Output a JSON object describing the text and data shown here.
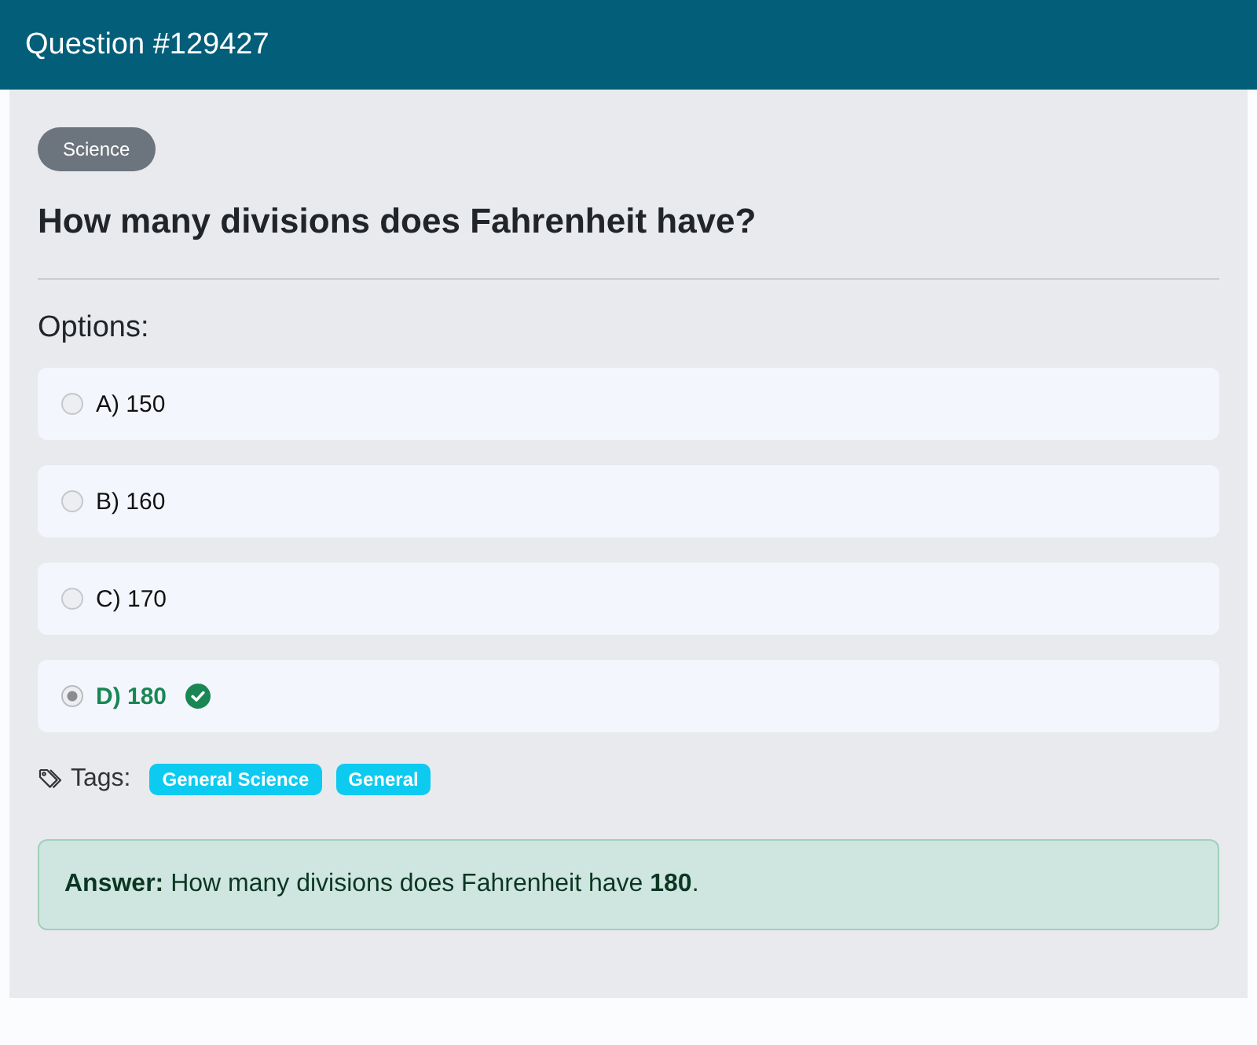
{
  "header": {
    "title": "Question #129427"
  },
  "category": {
    "label": "Science"
  },
  "question": {
    "text": "How many divisions does Fahrenheit have?"
  },
  "options_heading": "Options:",
  "options": [
    {
      "label": "A) 150",
      "selected": false,
      "correct": false
    },
    {
      "label": "B) 160",
      "selected": false,
      "correct": false
    },
    {
      "label": "C) 170",
      "selected": false,
      "correct": false
    },
    {
      "label": "D) 180",
      "selected": true,
      "correct": true
    }
  ],
  "tags": {
    "label": "Tags:",
    "items": [
      "General Science",
      "General"
    ]
  },
  "answer": {
    "text": "**Answer:** How many divisions does Fahrenheit have **180**."
  }
}
